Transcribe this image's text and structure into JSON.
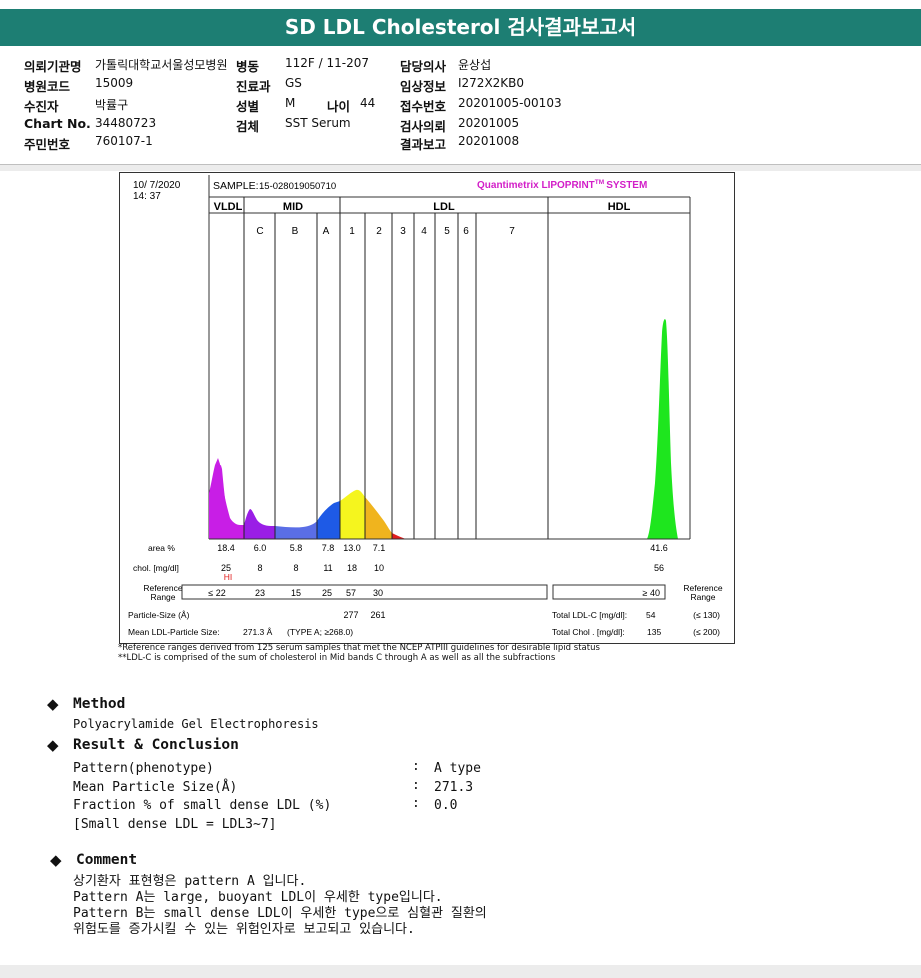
{
  "title": "SD LDL Cholesterol 검사결과보고서",
  "patient": {
    "row1": {
      "l1": "의뢰기관명",
      "v1": "가톨릭대학교서울성모병원",
      "l2": "병동",
      "v2": "112F / 11-207",
      "l3": "담당의사",
      "v3": "윤상섭"
    },
    "row2": {
      "l1": "병원코드",
      "v1": "15009",
      "l2": "진료과",
      "v2": "GS",
      "l3": "임상정보",
      "v3": "I272X2KB0"
    },
    "row3": {
      "l1": "수진자",
      "v1": "박률구",
      "l2": "성별",
      "v2": "M",
      "l2b": "나이",
      "v2b": "44",
      "l3": "접수번호",
      "v3": "20201005-00103"
    },
    "row4": {
      "l1": "Chart No.",
      "v1": "34480723",
      "l2": "검체",
      "v2": "SST Serum",
      "l3": "검사의뢰",
      "v3": "20201005"
    },
    "row5": {
      "l1": "주민번호",
      "v1": "760107-1",
      "l3": "결과보고",
      "v3": "20201008"
    }
  },
  "chart_data": {
    "type": "area",
    "date": "10/ 7/2020",
    "time": "14: 37",
    "sample_label": "SAMPLE:",
    "sample_id": "15-028019050710",
    "brand": "Quantimetrix LIPOPRINT",
    "brand_tm": "TM",
    "brand_suffix": "SYSTEM",
    "groups": [
      "VLDL",
      "MID",
      "LDL",
      "HDL"
    ],
    "bands": [
      "C",
      "B",
      "A",
      "1",
      "2",
      "3",
      "4",
      "5",
      "6",
      "7"
    ],
    "fill_colors": {
      "VLDL": "#c81ee6",
      "C": "#9a1ee6",
      "B": "#5a6ee6",
      "A": "#1e5ae6",
      "LDL1": "#f5f51e",
      "LDL2": "#f0b41e",
      "LDL3": "#e11e1e",
      "HDL": "#1ee61e"
    },
    "area_label": "area %",
    "area": {
      "VLDL": "18.4",
      "C": "6.0",
      "B": "5.8",
      "A": "7.8",
      "LDL1": "13.0",
      "LDL2": "7.1",
      "HDL": "41.6"
    },
    "chol_label": "chol. [mg/dl]",
    "chol": {
      "VLDL": "25",
      "C": "8",
      "B": "8",
      "A": "11",
      "LDL1": "18",
      "LDL2": "10",
      "HDL": "56"
    },
    "hi_flag": "HI",
    "ref_label": "Reference Range",
    "ref_label_1": "Reference",
    "ref_label_2": "Range",
    "ref": {
      "VLDL": "≤ 22",
      "C": "23",
      "B": "15",
      "A": "25",
      "LDL1": "57",
      "LDL2": "30",
      "HDL": "≥ 40"
    },
    "particle_size_label": "Particle-Size (Å)",
    "particle_size": {
      "LDL1": "277",
      "LDL2": "261"
    },
    "mean_ldl_label": "Mean LDL-Particle Size:",
    "mean_ldl_value": "271.3 Å",
    "mean_ldl_type": "(TYPE A; ≥268.0)",
    "total_ldl_label": "Total LDL-C [mg/dl]:",
    "total_ldl_value": "54",
    "total_ldl_ref": "(≤ 130)",
    "total_chol_label": "Total Chol . [mg/dl]:",
    "total_chol_value": "135",
    "total_chol_ref": "(≤ 200)"
  },
  "footnotes": [
    "*Reference ranges derived from 125 serum samples that met the NCEP ATPIII guidelines for desirable lipid status",
    "**LDL-C is comprised of the sum of cholesterol in Mid bands C through A as well as all the subfractions"
  ],
  "method": {
    "title": "Method",
    "text": "Polyacrylamide Gel Electrophoresis"
  },
  "result": {
    "title": "Result & Conclusion",
    "rows": [
      {
        "label": "Pattern(phenotype)",
        "sep": ":",
        "value": "A type"
      },
      {
        "label": "Mean Particle Size(Å)",
        "sep": ":",
        "value": "271.3"
      },
      {
        "label": "Fraction % of small dense LDL (%)",
        "sep": ":",
        "value": "0.0"
      }
    ],
    "note": "[Small dense LDL = LDL3~7]"
  },
  "comment": {
    "title": "Comment",
    "lines": [
      "상기환자 표현형은 pattern A 입니다.",
      "Pattern A는 large, buoyant LDL이 우세한 type입니다.",
      "Pattern B는 small dense LDL이 우세한 type으로 심혈관 질환의",
      "위험도를 증가시킬 수 있는 위험인자로 보고되고 있습니다."
    ]
  }
}
